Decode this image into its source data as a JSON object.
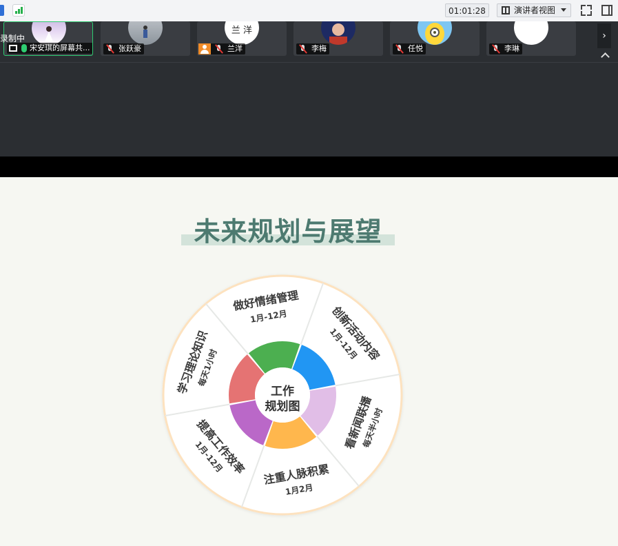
{
  "toolbar": {
    "timer": "01:01:28",
    "view_label": "演讲者视图",
    "icons": [
      "shield-icon",
      "signal-icon",
      "speaker-view-icon",
      "fullscreen-icon",
      "side-panel-icon"
    ]
  },
  "strip": {
    "recording_label": "录制中",
    "participants": [
      {
        "name": "宋安琪的屏幕共...",
        "mic": "on",
        "sharing": true
      },
      {
        "name": "张跃豪",
        "mic": "off"
      },
      {
        "name": "兰洋",
        "mic": "off",
        "avatar_text": "兰 洋"
      },
      {
        "name": "李梅",
        "mic": "off"
      },
      {
        "name": "任悦",
        "mic": "off"
      },
      {
        "name": "李琳",
        "mic": "off"
      }
    ],
    "next_arrow": "›"
  },
  "slide": {
    "title": "未来规划与展望",
    "center": {
      "line1": "工作",
      "line2": "规划图"
    },
    "segments": [
      {
        "title": "做好情绪管理",
        "sub": "1月-12月"
      },
      {
        "title": "创新活动内容",
        "sub": "1月-12月"
      },
      {
        "title": "看新闻联播",
        "sub": "每天半小时"
      },
      {
        "title": "注重人脉积累",
        "sub": "1月2月"
      },
      {
        "title": "提高工作效率",
        "sub": "1月-12月"
      },
      {
        "title": "学习理论知识",
        "sub": "每天1小时"
      }
    ],
    "ring_colors": [
      "#4caf50",
      "#2196f3",
      "#e1bee7",
      "#ffb74d",
      "#ba68c8",
      "#e57373"
    ],
    "accent": "#4d7a70"
  }
}
